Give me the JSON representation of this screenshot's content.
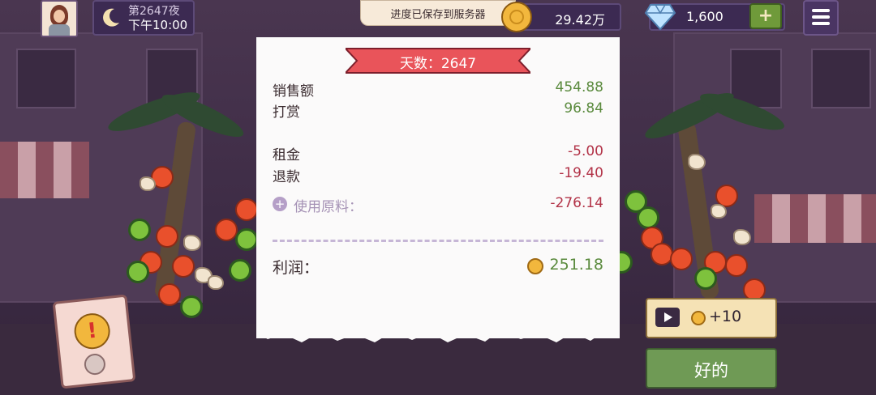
{
  "hud": {
    "night": "第2647夜",
    "time": "下午10:00",
    "toast": "进度已保存到服务器",
    "coins": "29.42万",
    "gems": "1,600",
    "add_symbol": "+"
  },
  "receipt": {
    "title": "天数：2647",
    "rows": [
      {
        "label": "销售额",
        "value": "454.88"
      },
      {
        "label": "打赏",
        "value": "96.84"
      },
      {
        "label": "租金",
        "value": "-5.00"
      },
      {
        "label": "退款",
        "value": "-19.40"
      },
      {
        "label": "使用原料：",
        "value": "-276.14"
      }
    ],
    "profit_label": "利润：",
    "profit_value": "251.18"
  },
  "buttons": {
    "ad_reward": "+10",
    "ok": "好的"
  },
  "icons": [
    "avatar",
    "moon-icon",
    "coin-icon",
    "diamond-icon",
    "plus-icon",
    "menu-icon",
    "alert-card-icon",
    "play-icon",
    "expand-icon"
  ],
  "colors": {
    "positive": "#5a8a3d",
    "negative": "#b23247",
    "ok_button": "#6f9a55",
    "banner": "#e9545a"
  }
}
